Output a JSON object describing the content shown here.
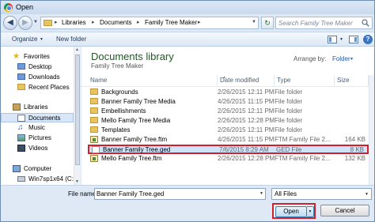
{
  "window": {
    "title": "Open",
    "app_icon": "chrome-icon"
  },
  "address": {
    "breadcrumbs": [
      "Libraries",
      "Documents",
      "Family Tree Maker"
    ],
    "search_placeholder": "Search Family Tree Maker"
  },
  "toolbar": {
    "organize_label": "Organize",
    "new_folder_label": "New folder"
  },
  "nav": {
    "favorites": "Favorites",
    "favorite_items": [
      "Desktop",
      "Downloads",
      "Recent Places"
    ],
    "libraries": "Libraries",
    "library_items": [
      "Documents",
      "Music",
      "Pictures",
      "Videos"
    ],
    "computer": "Computer",
    "computer_items": [
      "Win7sp1x64 (C:)"
    ]
  },
  "library": {
    "title": "Documents library",
    "subtitle": "Family Tree Maker",
    "arrange_label": "Arrange by:",
    "arrange_value": "Folder"
  },
  "columns": {
    "name": "Name",
    "date": "Date modified",
    "type": "Type",
    "size": "Size"
  },
  "files": [
    {
      "name": "Backgrounds",
      "date": "2/26/2015 12:11 PM",
      "type": "File folder",
      "size": "",
      "icon": "folder"
    },
    {
      "name": "Banner Family Tree Media",
      "date": "4/26/2015 11:15 PM",
      "type": "File folder",
      "size": "",
      "icon": "folder"
    },
    {
      "name": "Embellishments",
      "date": "2/26/2015 12:11 PM",
      "type": "File folder",
      "size": "",
      "icon": "folder"
    },
    {
      "name": "Mello Family Tree Media",
      "date": "2/26/2015 12:28 PM",
      "type": "File folder",
      "size": "",
      "icon": "folder"
    },
    {
      "name": "Templates",
      "date": "2/26/2015 12:11 PM",
      "type": "File folder",
      "size": "",
      "icon": "folder"
    },
    {
      "name": "Banner Family Tree.ftm",
      "date": "4/26/2015 11:15 PM",
      "type": "FTM Family File 2...",
      "size": "164 KB",
      "icon": "ftm"
    },
    {
      "name": "Banner Family Tree.ged",
      "date": "7/6/2015 8:29 AM",
      "type": "GED File",
      "size": "8 KB",
      "icon": "generic",
      "selected": true
    },
    {
      "name": "Mello Family Tree.ftm",
      "date": "2/26/2015 12:28 PM",
      "type": "FTM Family File 2...",
      "size": "132 KB",
      "icon": "ftm"
    }
  ],
  "footer": {
    "file_name_label": "File name:",
    "file_name_value": "Banner Family Tree.ged",
    "file_type_value": "All Files",
    "open_label": "Open",
    "cancel_label": "Cancel"
  },
  "colors": {
    "highlight_border": "#d0202c",
    "library_title": "#1e5b22",
    "selection": "#cfe3fb"
  }
}
